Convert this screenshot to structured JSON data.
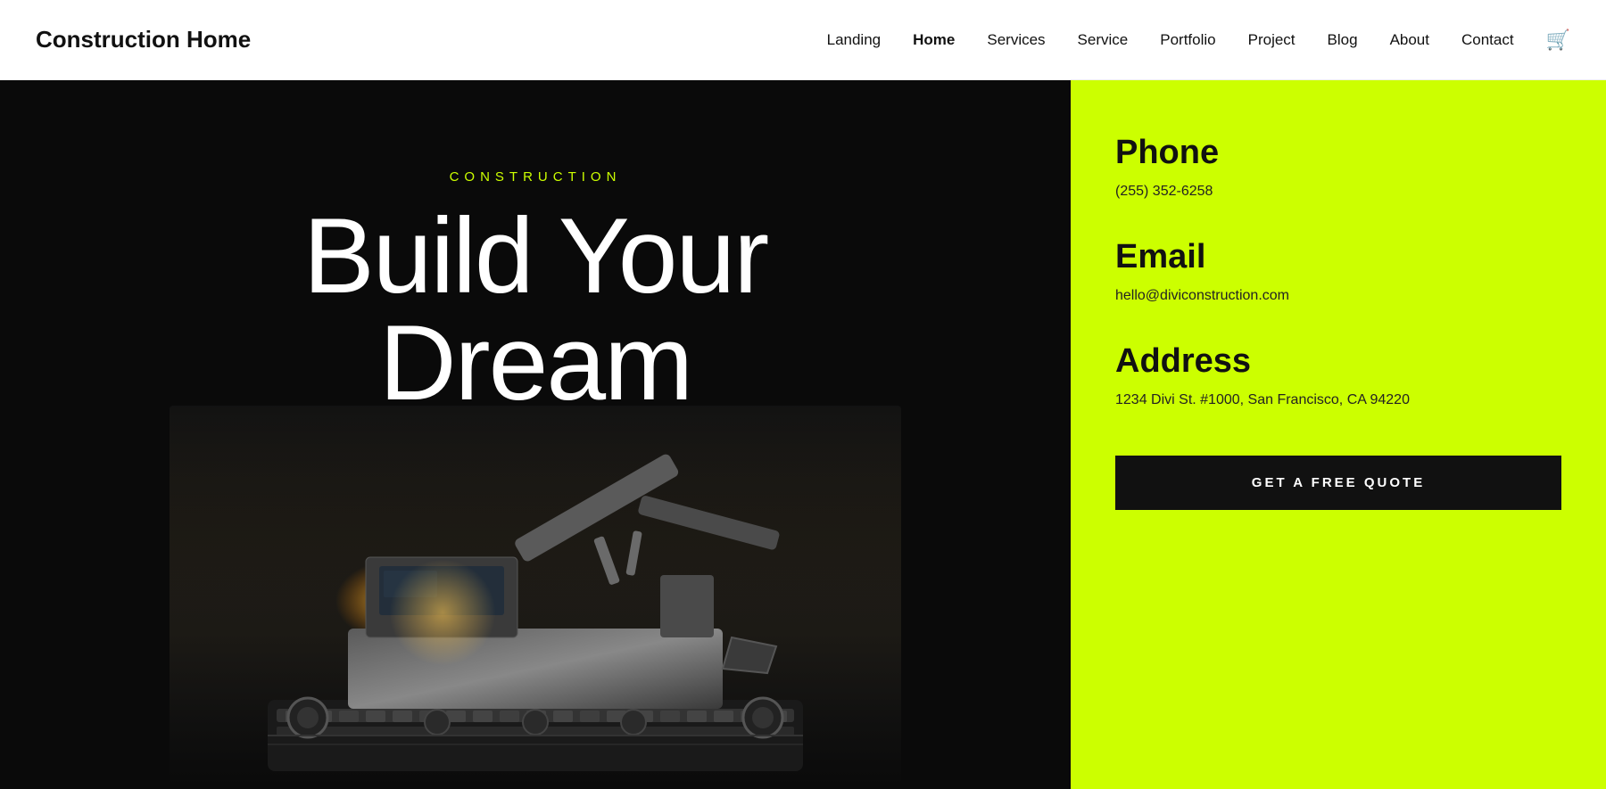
{
  "header": {
    "logo": "Construction Home",
    "nav": [
      {
        "label": "Landing",
        "active": false
      },
      {
        "label": "Home",
        "active": true
      },
      {
        "label": "Services",
        "active": false
      },
      {
        "label": "Service",
        "active": false
      },
      {
        "label": "Portfolio",
        "active": false
      },
      {
        "label": "Project",
        "active": false
      },
      {
        "label": "Blog",
        "active": false
      },
      {
        "label": "About",
        "active": false
      },
      {
        "label": "Contact",
        "active": false
      }
    ],
    "cart_icon": "🛒"
  },
  "hero": {
    "label": "CONSTRUCTION",
    "title_line1": "Build Your",
    "title_line2": "Dream"
  },
  "sidebar": {
    "phone_heading": "Phone",
    "phone_value": "(255) 352-6258",
    "email_heading": "Email",
    "email_value": "hello@diviconstruction.com",
    "address_heading": "Address",
    "address_value": "1234 Divi St. #1000, San Francisco, CA 94220",
    "cta_label": "GET A FREE QUOTE"
  },
  "colors": {
    "accent": "#ccff00",
    "dark": "#0a0a0a",
    "white": "#ffffff"
  }
}
